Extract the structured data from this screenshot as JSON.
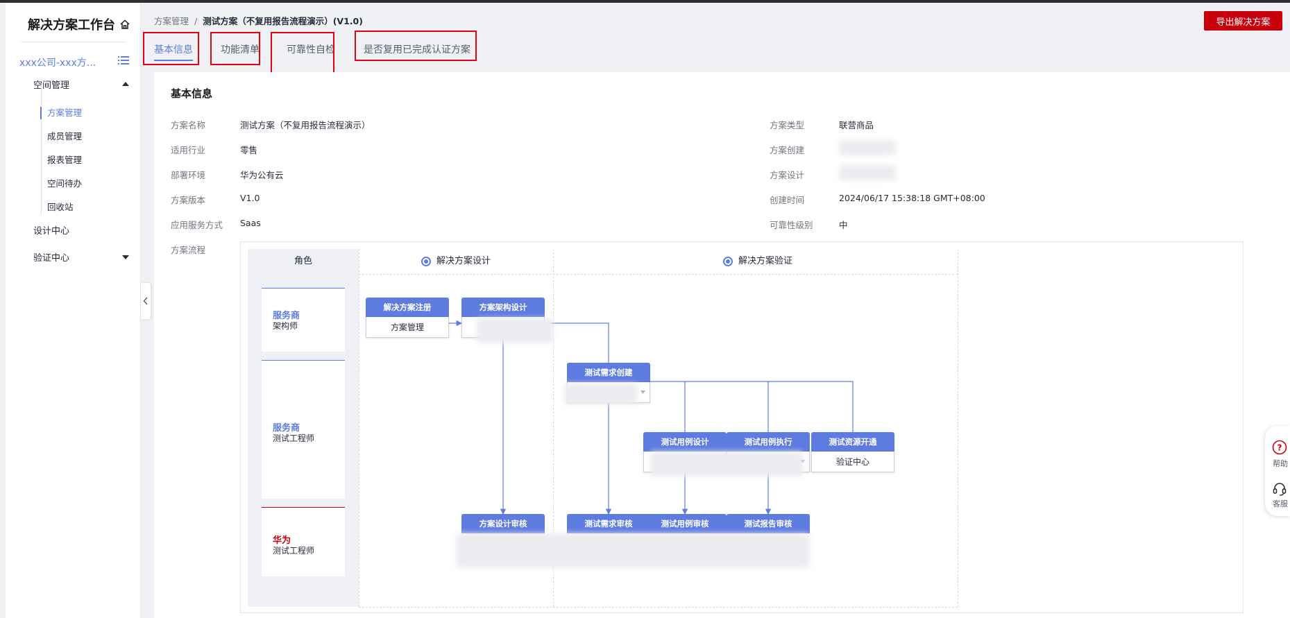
{
  "sidebar": {
    "brand": "解决方案工作台",
    "space_name": "xxx公司-xxx方...",
    "groups": {
      "space": "空间管理",
      "design": "设计中心",
      "verify": "验证中心"
    },
    "sub_items": [
      "方案管理",
      "成员管理",
      "报表管理",
      "空间待办",
      "回收站"
    ]
  },
  "header": {
    "breadcrumb_parent": "方案管理",
    "breadcrumb_sep": "/",
    "breadcrumb_current": "测试方案（不复用报告流程演示）(V1.0)",
    "export_label": "导出解决方案"
  },
  "tabs": [
    "基本信息",
    "功能清单",
    "可靠性自检",
    "是否复用已完成认证方案"
  ],
  "basic_info": {
    "title": "基本信息",
    "left": [
      {
        "label": "方案名称",
        "value": "测试方案（不复用报告流程演示）"
      },
      {
        "label": "适用行业",
        "value": "零售"
      },
      {
        "label": "部署环境",
        "value": "华为公有云"
      },
      {
        "label": "方案版本",
        "value": "V1.0"
      },
      {
        "label": "应用服务方式",
        "value": "Saas"
      }
    ],
    "right": [
      {
        "label": "方案类型",
        "value": "联营商品"
      },
      {
        "label": "方案创建",
        "value": ""
      },
      {
        "label": "方案设计",
        "value": ""
      },
      {
        "label": "创建时间",
        "value": "2024/06/17 15:38:18 GMT+08:00"
      },
      {
        "label": "可靠性级别",
        "value": "中"
      }
    ],
    "flow_label": "方案流程"
  },
  "flow": {
    "role_header": "角色",
    "stages": [
      "解决方案设计",
      "解决方案验证"
    ],
    "roles": [
      {
        "org": "服务商",
        "role": "架构师",
        "color": "#5e7ce0"
      },
      {
        "org": "服务商",
        "role": "测试工程师",
        "color": "#5e7ce0"
      },
      {
        "org": "华为",
        "role": "测试工程师",
        "color": "#c7000b"
      }
    ],
    "nodes": {
      "reg": {
        "title": "解决方案注册",
        "body": "方案管理"
      },
      "arch": {
        "title": "方案架构设计"
      },
      "req": {
        "title": "测试需求创建"
      },
      "case": {
        "title": "测试用例设计"
      },
      "exec": {
        "title": "测试用例执行"
      },
      "res": {
        "title": "测试资源开通",
        "body": "验证中心"
      },
      "review_design": {
        "title": "方案设计审核"
      },
      "review_req": {
        "title": "测试需求审核"
      },
      "review_case": {
        "title": "测试用例审核"
      },
      "review_report": {
        "title": "测试报告审核"
      }
    }
  },
  "float": {
    "help": "帮助",
    "service": "客服"
  },
  "colors": {
    "primary": "#5e7ce0",
    "brand_red": "#c7000b",
    "annotation_red": "#e4000f"
  }
}
